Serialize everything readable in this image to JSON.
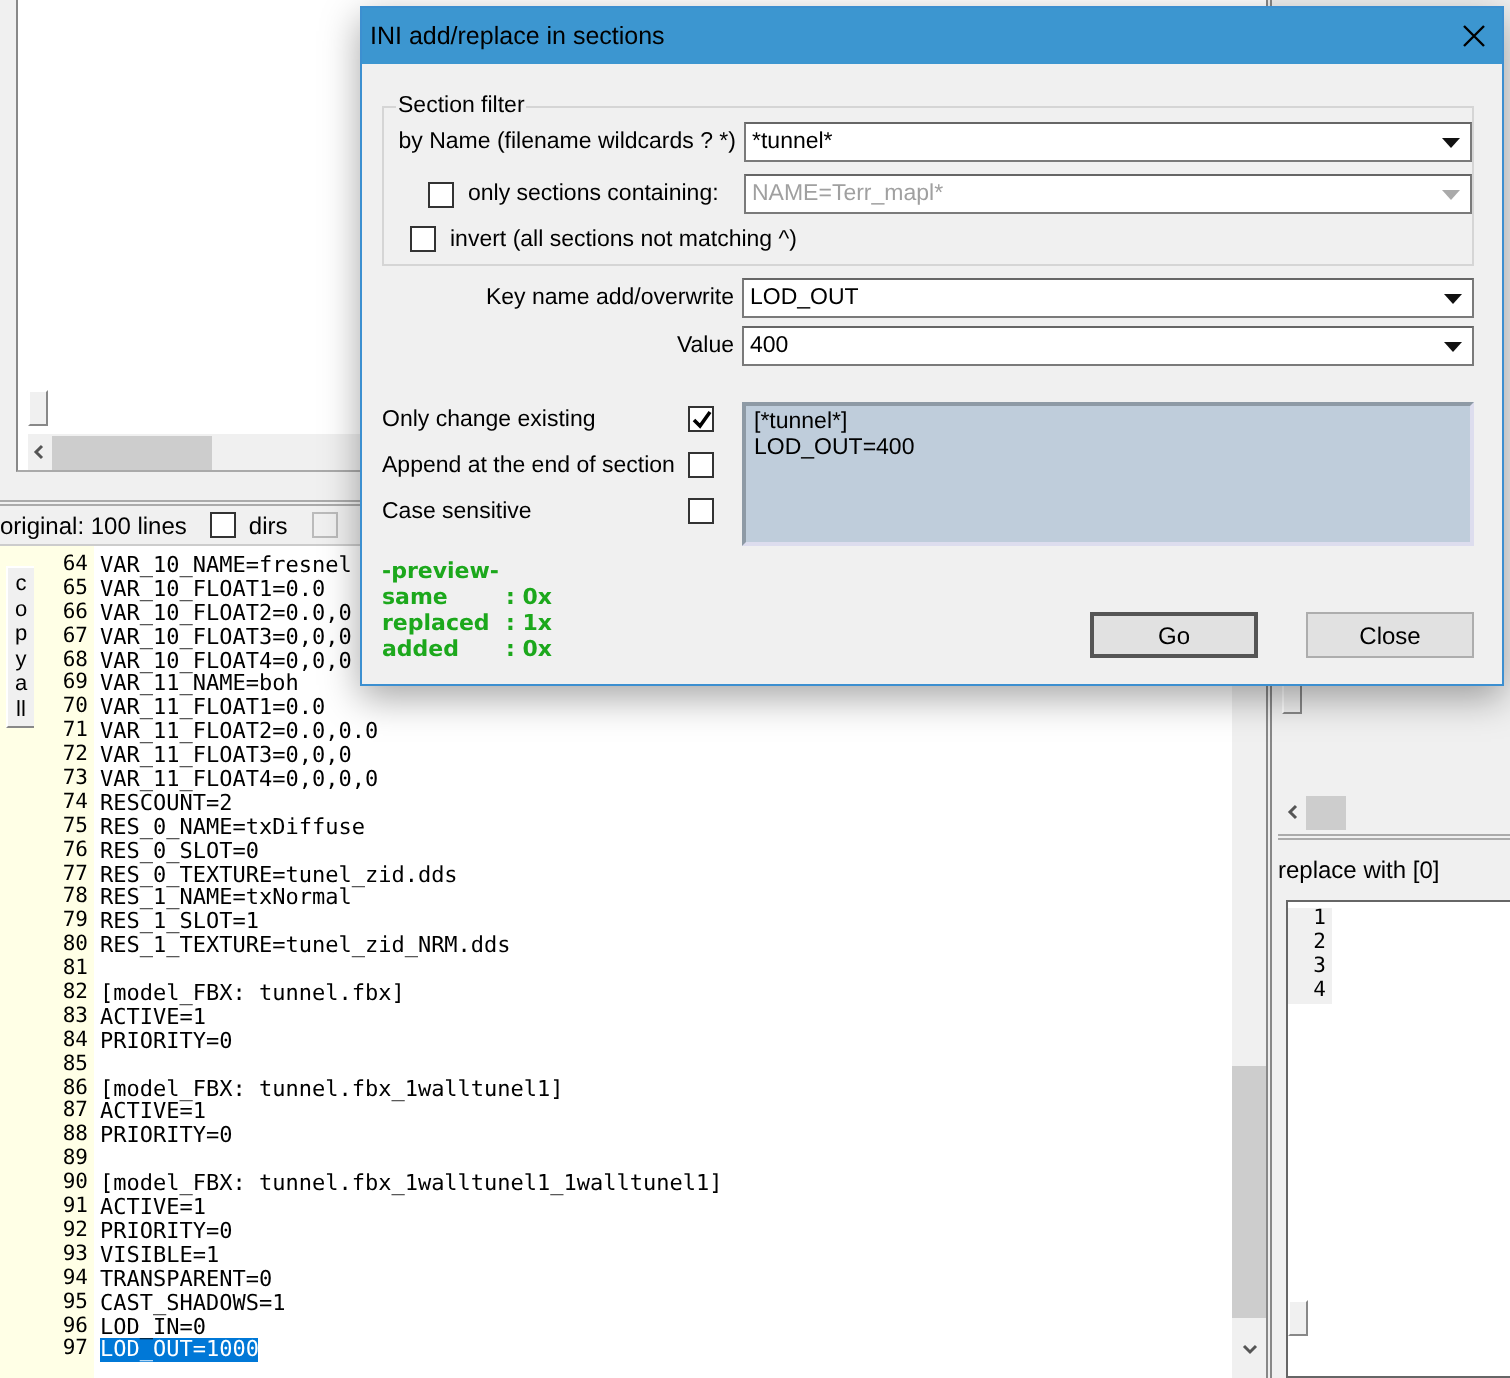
{
  "status_bar": {
    "label": "original: 100 lines",
    "checkboxes": [
      {
        "label": "dirs",
        "checked": false,
        "disabled": false
      },
      {
        "checked": false,
        "disabled": true
      }
    ]
  },
  "copy_all_button": "copyall",
  "editor": {
    "lines": [
      {
        "number": "64",
        "text": "VAR_10_NAME=fresnel",
        "selected": false
      },
      {
        "number": "65",
        "text": "VAR_10_FLOAT1=0.0",
        "selected": false
      },
      {
        "number": "66",
        "text": "VAR_10_FLOAT2=0.0,0",
        "selected": false
      },
      {
        "number": "67",
        "text": "VAR_10_FLOAT3=0,0,0",
        "selected": false
      },
      {
        "number": "68",
        "text": "VAR_10_FLOAT4=0,0,0",
        "selected": false
      },
      {
        "number": "69",
        "text": "VAR_11_NAME=boh",
        "selected": false
      },
      {
        "number": "70",
        "text": "VAR_11_FLOAT1=0.0",
        "selected": false
      },
      {
        "number": "71",
        "text": "VAR_11_FLOAT2=0.0,0.0",
        "selected": false
      },
      {
        "number": "72",
        "text": "VAR_11_FLOAT3=0,0,0",
        "selected": false
      },
      {
        "number": "73",
        "text": "VAR_11_FLOAT4=0,0,0,0",
        "selected": false
      },
      {
        "number": "74",
        "text": "RESCOUNT=2",
        "selected": false
      },
      {
        "number": "75",
        "text": "RES_0_NAME=txDiffuse",
        "selected": false
      },
      {
        "number": "76",
        "text": "RES_0_SLOT=0",
        "selected": false
      },
      {
        "number": "77",
        "text": "RES_0_TEXTURE=tunel_zid.dds",
        "selected": false
      },
      {
        "number": "78",
        "text": "RES_1_NAME=txNormal",
        "selected": false
      },
      {
        "number": "79",
        "text": "RES_1_SLOT=1",
        "selected": false
      },
      {
        "number": "80",
        "text": "RES_1_TEXTURE=tunel_zid_NRM.dds",
        "selected": false
      },
      {
        "number": "81",
        "selected": false
      },
      {
        "number": "82",
        "text": "[model_FBX: tunnel.fbx]",
        "selected": false
      },
      {
        "number": "83",
        "text": "ACTIVE=1",
        "selected": false
      },
      {
        "number": "84",
        "text": "PRIORITY=0",
        "selected": false
      },
      {
        "number": "85",
        "selected": false
      },
      {
        "number": "86",
        "text": "[model_FBX: tunnel.fbx_1walltunel1]",
        "selected": false
      },
      {
        "number": "87",
        "text": "ACTIVE=1",
        "selected": false
      },
      {
        "number": "88",
        "text": "PRIORITY=0",
        "selected": false
      },
      {
        "number": "89",
        "selected": false
      },
      {
        "number": "90",
        "text": "[model_FBX: tunnel.fbx_1walltunel1_1walltunel1]",
        "selected": false
      },
      {
        "number": "91",
        "text": "ACTIVE=1",
        "selected": false
      },
      {
        "number": "92",
        "text": "PRIORITY=0",
        "selected": false
      },
      {
        "number": "93",
        "text": "VISIBLE=1",
        "selected": false
      },
      {
        "number": "94",
        "text": "TRANSPARENT=0",
        "selected": false
      },
      {
        "number": "95",
        "text": "CAST_SHADOWS=1",
        "selected": false
      },
      {
        "number": "96",
        "text": "LOD_IN=0",
        "selected": false
      },
      {
        "number": "97",
        "text": "LOD_OUT=1000",
        "selected": true
      }
    ]
  },
  "right_pane": {
    "label": "replace with [0]",
    "line_numbers": [
      "1",
      "2",
      "3",
      "4"
    ]
  },
  "dialog": {
    "title": "INI add/replace in sections",
    "section_filter": {
      "title": "Section filter",
      "name": {
        "label": "by Name (filename wildcards ? *)",
        "value": "*tunnel*"
      },
      "containing": {
        "label": "only sections containing:",
        "checked": false,
        "value": "NAME=Terr_mapl*",
        "disabled": true
      },
      "invert": {
        "label": "invert (all sections not matching ^)",
        "checked": false
      }
    },
    "key": {
      "label": "Key name add/overwrite",
      "value": "LOD_OUT"
    },
    "value": {
      "label": "Value",
      "value": "400"
    },
    "options": [
      {
        "label": "Only change existing",
        "checked": true
      },
      {
        "label": "Append at the end of section",
        "checked": false
      },
      {
        "label": "Case sensitive",
        "checked": false
      }
    ],
    "result_lines": [
      "[*tunnel*]",
      "LOD_OUT=400"
    ],
    "preview": {
      "heading": "-preview-",
      "rows": [
        {
          "label": "same",
          "value": ": 0x"
        },
        {
          "label": "replaced",
          "value": ": 1x"
        },
        {
          "label": "added",
          "value": ": 0x"
        }
      ]
    },
    "buttons": [
      "Go",
      "Close"
    ]
  }
}
